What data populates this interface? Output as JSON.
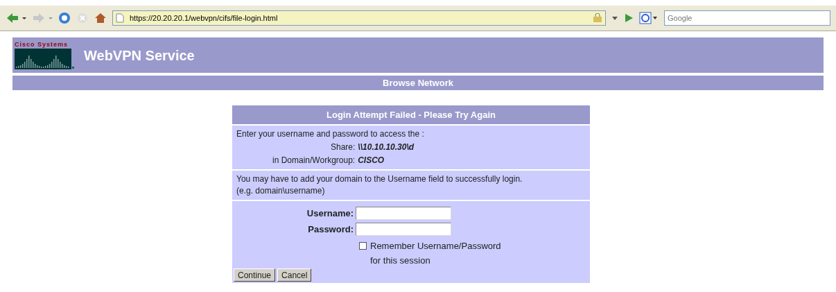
{
  "browser": {
    "url": "https://20.20.20.1/webvpn/cifs/file-login.html",
    "search_placeholder": "Google"
  },
  "header": {
    "logo_text": "Cisco Systems",
    "title": "WebVPN Service"
  },
  "nav": {
    "label": "Browse Network"
  },
  "login": {
    "title": "Login Attempt Failed - Please Try Again",
    "intro": "Enter your username and password to access the :",
    "share": {
      "label": "Share:",
      "value": "\\\\10.10.10.30\\d"
    },
    "domain": {
      "label": "in Domain/Workgroup:",
      "value": "CISCO"
    },
    "hint_lines": [
      "You may have to add your domain to the Username field to successfully login.",
      "(e.g. domain\\username)"
    ],
    "fields": [
      {
        "label": "Username:"
      },
      {
        "label": "Password:"
      }
    ],
    "remember": {
      "label": "Remember Username/Password",
      "sublabel": "for this session",
      "checked": false
    },
    "buttons": [
      "Continue",
      "Cancel"
    ]
  }
}
